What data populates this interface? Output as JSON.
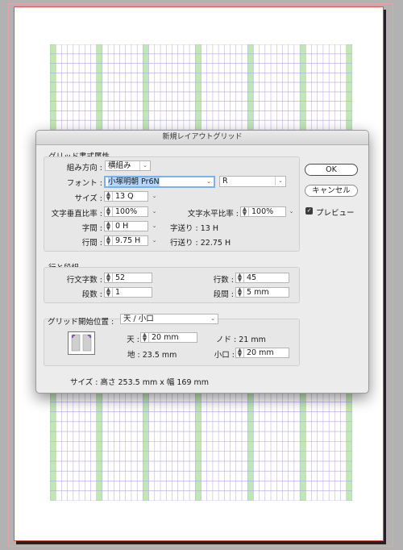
{
  "dialog": {
    "title": "新規レイアウトグリッド",
    "grid_format": {
      "title": "グリッド書式属性",
      "direction_label": "組み方向 :",
      "direction_value": "横組み",
      "font_label": "フォント :",
      "font_value": "小塚明朝 Pr6N",
      "font_style": "R",
      "size_label": "サイズ :",
      "size_value": "13 Q",
      "vscale_label": "文字垂直比率 :",
      "vscale_value": "100%",
      "hscale_label": "文字水平比率 :",
      "hscale_value": "100%",
      "char_space_label": "字間 :",
      "char_space_value": "0 H",
      "char_advance_text": "字送り : 13 H",
      "line_gap_label": "行間 :",
      "line_gap_value": "9.75 H",
      "line_advance_text": "行送り : 22.75 H"
    },
    "lines_columns": {
      "title": "行と段組",
      "chars_per_line_label": "行文字数 :",
      "chars_per_line_value": "52",
      "lines_label": "行数 :",
      "lines_value": "45",
      "columns_label": "段数 :",
      "columns_value": "1",
      "gutter_label": "段間 :",
      "gutter_value": "5 mm"
    },
    "grid_start": {
      "label": "グリッド開始位置 :",
      "value": "天 / 小口",
      "top_label": "天 :",
      "top_value": "20 mm",
      "bottom_text": "地 : 23.5 mm",
      "gutter_edge_text": "ノド : 21 mm",
      "outside_label": "小口 :",
      "outside_value": "20 mm"
    },
    "size_summary": "サイズ : 高さ 253.5 mm x 幅 169 mm",
    "buttons": {
      "ok": "OK",
      "cancel": "キャンセル",
      "preview": "プレビュー",
      "preview_checked": true
    }
  },
  "icons": {
    "spinner": "spinner-arrows-icon",
    "dropdown": "chevron-down-icon",
    "checkbox": "checkbox-checked-icon",
    "grid_start_preview": "grid-start-preview-icon"
  },
  "colors": {
    "grid_line": "#b8a6e8",
    "grid_fill": "#bfe8b4",
    "page_border": "#d9534f",
    "font_highlight": "#b3d7ff"
  }
}
